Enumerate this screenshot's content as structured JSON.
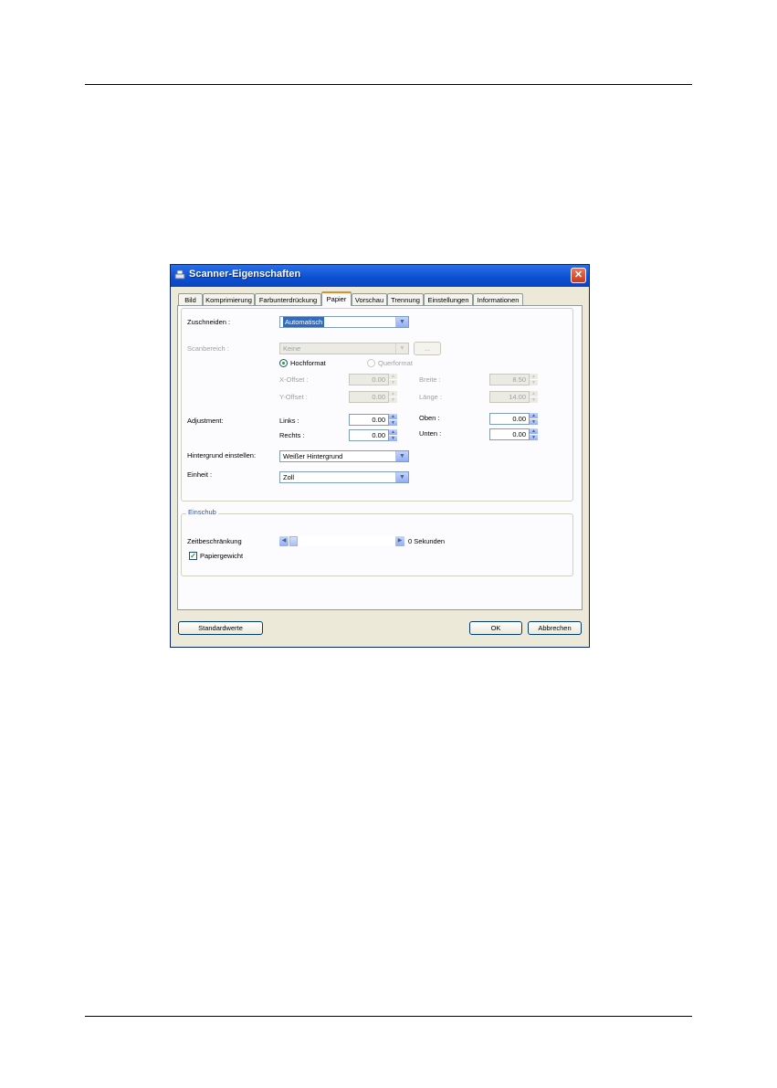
{
  "window": {
    "title": "Scanner-Eigenschaften",
    "close_glyph": "✕",
    "icon": "scanner-icon"
  },
  "tabs": [
    {
      "label": "Bild"
    },
    {
      "label": "Komprimierung"
    },
    {
      "label": "Farbunterdrückung"
    },
    {
      "label": "Papier",
      "active": true
    },
    {
      "label": "Vorschau"
    },
    {
      "label": "Trennung"
    },
    {
      "label": "Einstellungen"
    },
    {
      "label": "Informationen"
    }
  ],
  "papier": {
    "zuschneiden_label": "Zuschneiden :",
    "zuschneiden_value": "Automatisch",
    "scanbereich_label": "Scanbereich :",
    "scanbereich_value": "Keine",
    "scanbereich_button": "...",
    "hochformat_label": "Hochformat",
    "querformat_label": "Querformat",
    "xoffset_label": "X-Offset :",
    "xoffset_value": "0.00",
    "yoffset_label": "Y-Offset :",
    "yoffset_value": "0.00",
    "breite_label": "Breite :",
    "breite_value": "8.50",
    "laenge_label": "Länge :",
    "laenge_value": "14.00",
    "adjustment_label": "Adjustment:",
    "links_label": "Links :",
    "links_value": "0.00",
    "rechts_label": "Rechts :",
    "rechts_value": "0.00",
    "oben_label": "Oben :",
    "oben_value": "0.00",
    "unten_label": "Unten :",
    "unten_value": "0.00",
    "hintergrund_label": "Hintergrund einstellen:",
    "hintergrund_value": "Weißer Hintergrund",
    "einheit_label": "Einheit :",
    "einheit_value": "Zoll"
  },
  "einschub": {
    "legend": "Einschub",
    "zeitbeschraenkung_label": "Zeitbeschränkung",
    "slider_value": "0 Sekunden",
    "papiergewicht_label": "Papiergewicht",
    "papiergewicht_checked": true
  },
  "buttons": {
    "standardwerte": "Standardwerte",
    "ok": "OK",
    "abbrechen": "Abbrechen"
  }
}
